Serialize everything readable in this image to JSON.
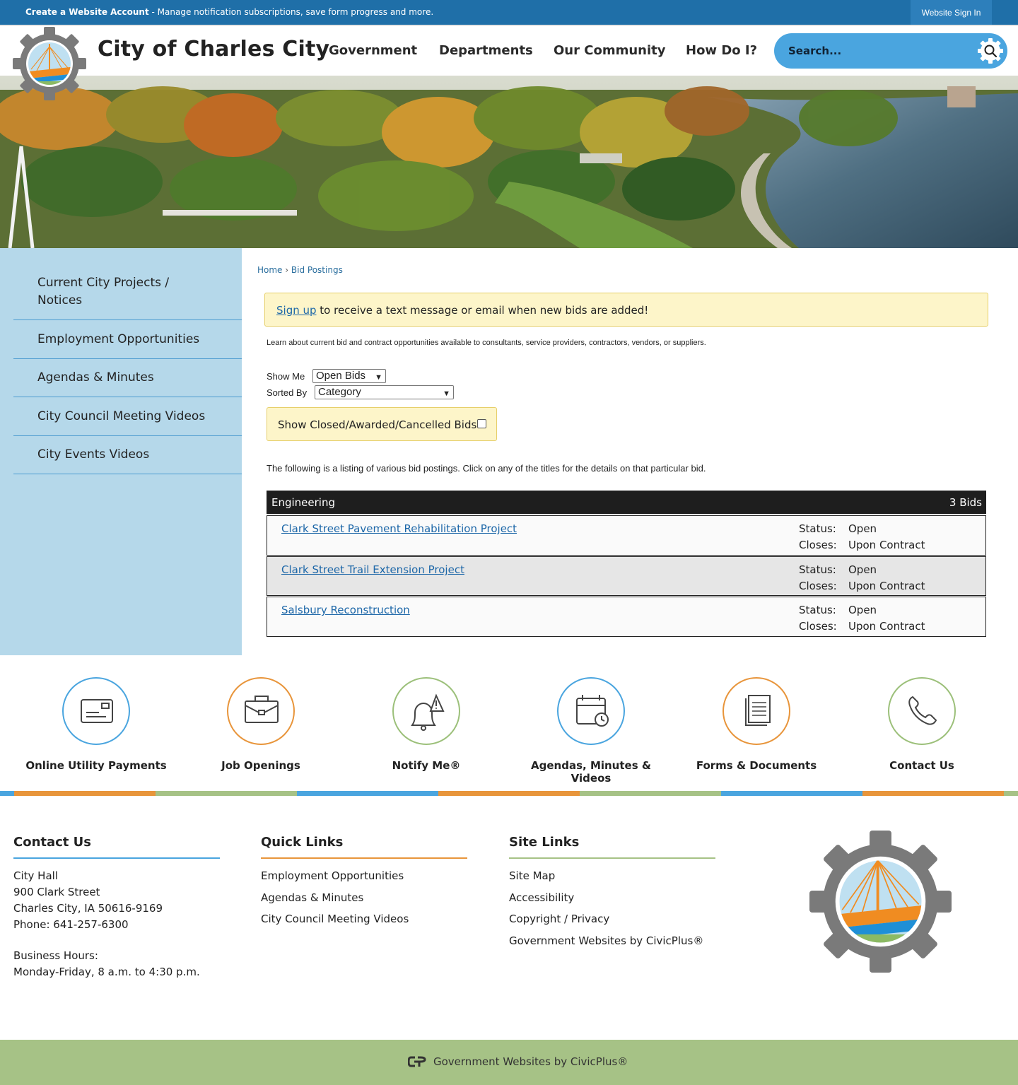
{
  "topbar": {
    "create_account": "Create a Website Account",
    "create_account_desc": " - Manage notification subscriptions, save form progress and more.",
    "signin": "Website Sign In"
  },
  "header": {
    "title": "City of Charles City",
    "nav": [
      "Government",
      "Departments",
      "Our Community",
      "How Do I?"
    ],
    "search_placeholder": "Search...",
    "logo_icon": "city-gear-logo-icon"
  },
  "sidebar": {
    "items": [
      {
        "label": "Current City Projects /"
      },
      {
        "label": "Notices"
      },
      {
        "label": "Employment Opportunities"
      },
      {
        "label": "Agendas & Minutes"
      },
      {
        "label": "City Council Meeting Videos"
      },
      {
        "label": "City Events Videos"
      }
    ]
  },
  "breadcrumb": {
    "home": "Home",
    "sep": "›",
    "current": "Bid Postings"
  },
  "alert": {
    "link": "Sign up",
    "text": " to receive a text message or email when new bids are added!"
  },
  "intro": "Learn about current bid and contract opportunities available to consultants, service providers, contractors, vendors, or suppliers.",
  "filters": {
    "show_me_label": "Show Me",
    "show_me_value": "Open Bids",
    "sorted_by_label": "Sorted By",
    "sorted_by_value": "Category",
    "closed_label": "Show Closed/Awarded/Cancelled Bids:"
  },
  "listing_text": "The following is a listing of various bid postings. Click on any of the titles for the details on that particular bid.",
  "category": {
    "name": "Engineering",
    "count": "3 Bids",
    "bids": [
      {
        "title": "Clark Street Pavement Rehabilitation Project",
        "status_label": "Status:",
        "status": "Open",
        "closes_label": "Closes:",
        "closes": "Upon Contract"
      },
      {
        "title": "Clark Street Trail Extension Project",
        "status_label": "Status:",
        "status": "Open",
        "closes_label": "Closes:",
        "closes": "Upon Contract"
      },
      {
        "title": "Salsbury Reconstruction",
        "status_label": "Status:",
        "status": "Open",
        "closes_label": "Closes:",
        "closes": "Upon Contract"
      }
    ]
  },
  "quick_links": [
    {
      "label": "Online Utility Payments",
      "icon": "payment-card-icon",
      "color": "#4aa5df"
    },
    {
      "label": "Job Openings",
      "icon": "briefcase-icon",
      "color": "#e8953b"
    },
    {
      "label": "Notify Me®",
      "icon": "bell-alert-icon",
      "color": "#9cc07a"
    },
    {
      "label": "Agendas, Minutes & Videos",
      "icon": "calendar-clock-icon",
      "color": "#4aa5df"
    },
    {
      "label": "Forms & Documents",
      "icon": "documents-icon",
      "color": "#e8953b"
    },
    {
      "label": "Contact Us",
      "icon": "phone-icon",
      "color": "#9cc07a"
    }
  ],
  "footer": {
    "contact": {
      "title": "Contact Us",
      "line1": "City Hall",
      "line2": "900 Clark Street",
      "line3": "Charles City, IA 50616-9169",
      "line4": "Phone: 641-257-6300",
      "hours_label": "Business Hours:",
      "hours": "Monday-Friday, 8 a.m. to 4:30 p.m."
    },
    "quick": {
      "title": "Quick Links",
      "items": [
        "Employment Opportunities",
        "Agendas & Minutes",
        "City Council Meeting Videos"
      ]
    },
    "site": {
      "title": "Site Links",
      "items": [
        "Site Map",
        "Accessibility",
        "Copyright / Privacy",
        "Government Websites by CivicPlus®"
      ]
    },
    "bottom_text": "Government Websites by CivicPlus®"
  },
  "colors": {
    "blue": "#4aa5df",
    "orange": "#e8953b",
    "green": "#9cc07a",
    "dark_blue": "#1f6fa8"
  }
}
